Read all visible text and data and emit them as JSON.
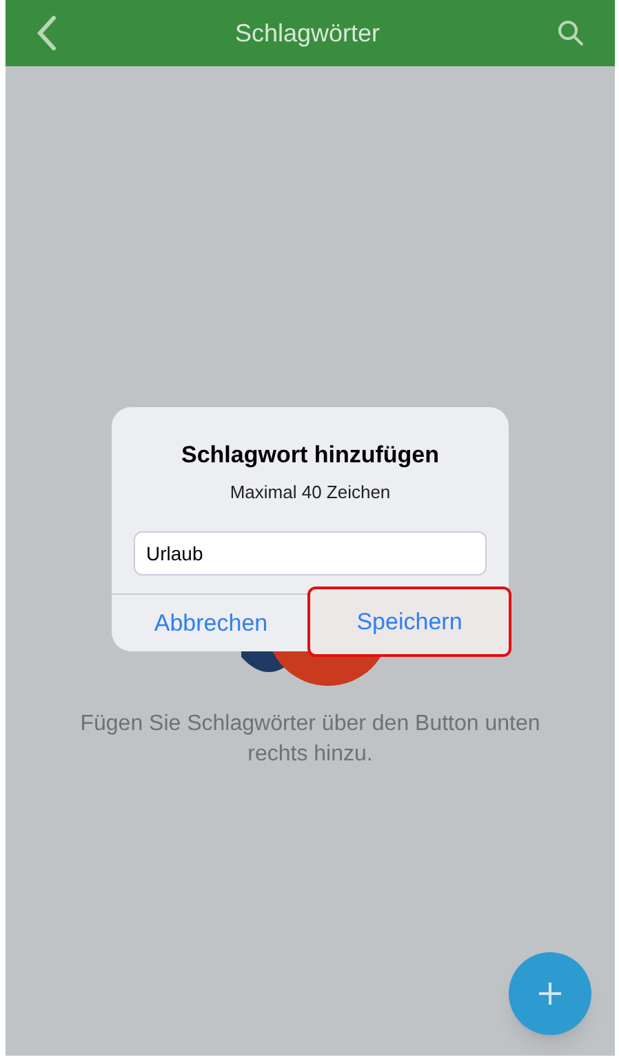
{
  "header": {
    "title": "Schlagwörter"
  },
  "empty_state": {
    "message": "Fügen Sie Schlagwörter über den Button unten rechts hinzu."
  },
  "dialog": {
    "title": "Schlagwort hinzufügen",
    "subtitle": "Maximal 40 Zeichen",
    "field": {
      "value": "Urlaub"
    },
    "buttons": [
      {
        "label": "Abbrechen",
        "highlighted": false
      },
      {
        "label": "Speichern",
        "highlighted": true
      }
    ]
  }
}
